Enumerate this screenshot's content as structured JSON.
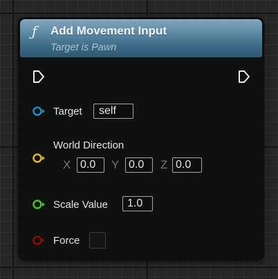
{
  "node": {
    "title": "Add Movement Input",
    "subtitle": "Target is Pawn",
    "icon": "function-icon"
  },
  "pins": {
    "exec_in": "exec-in-pin",
    "exec_out": "exec-out-pin",
    "target": {
      "label": "Target",
      "value": "self",
      "color": "#1a8fd6"
    },
    "world_direction": {
      "label": "World Direction",
      "color": "#e6b52b",
      "x_label": "X",
      "x_value": "0.0",
      "y_label": "Y",
      "y_value": "0.0",
      "z_label": "Z",
      "z_value": "0.0"
    },
    "scale_value": {
      "label": "Scale Value",
      "value": "1.0",
      "color": "#3bc82a"
    },
    "force": {
      "label": "Force",
      "checked": false,
      "color": "#8f0b0b"
    }
  }
}
